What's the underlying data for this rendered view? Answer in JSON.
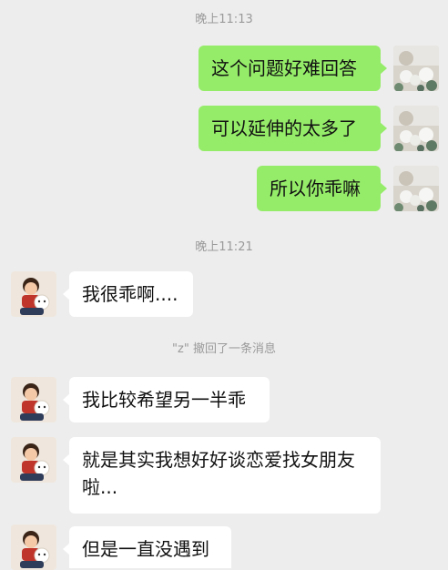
{
  "chat": {
    "timestamps": [
      "晚上11:13",
      "晚上11:21"
    ],
    "system_notice": "\"z\" 撤回了一条消息",
    "messages_outgoing": [
      "这个问题好难回答",
      "可以延伸的太多了",
      "所以你乖嘛"
    ],
    "messages_incoming": [
      "我很乖啊....",
      "我比较希望另一半乖",
      "就是其实我想好好谈恋爱找女朋友啦...",
      "但是一直没遇到"
    ],
    "colors": {
      "background": "#ededed",
      "outgoing_bubble": "#95ec69",
      "incoming_bubble": "#ffffff",
      "timestamp_text": "#9a9a9a"
    }
  }
}
